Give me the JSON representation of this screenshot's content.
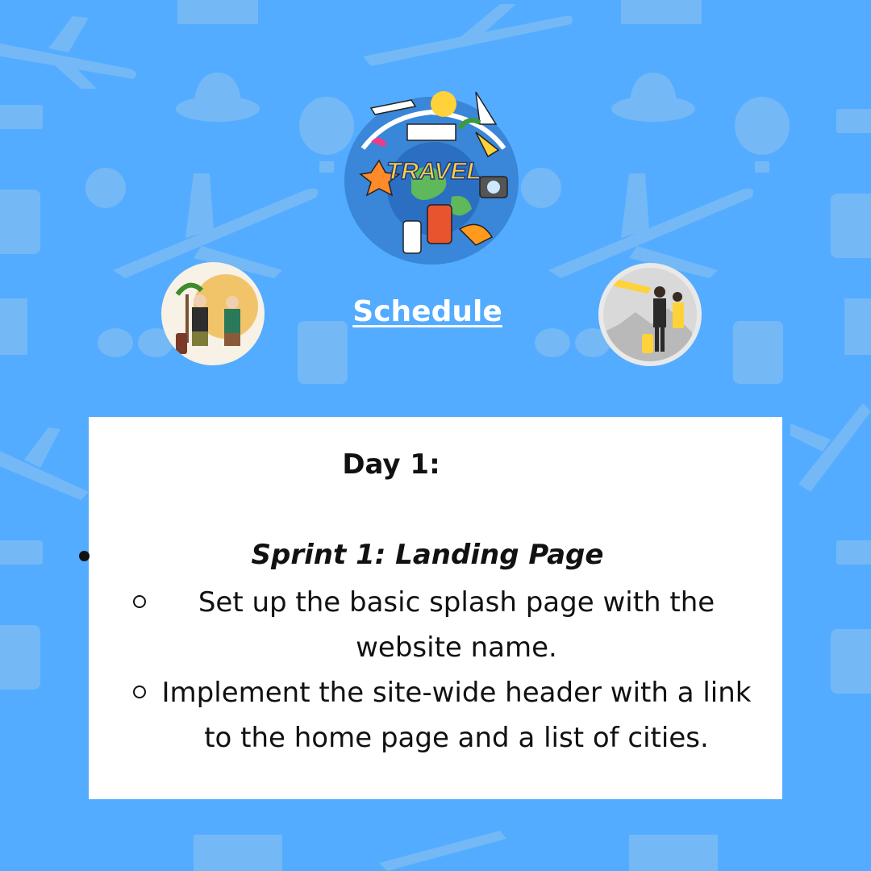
{
  "heading": "Schedule",
  "day": {
    "title": "Day 1:",
    "sprint": "Sprint 1: Landing Page",
    "tasks": [
      "Set up the basic splash page with the website name.",
      "Implement the site-wide header with a link to the home page and a list of cities."
    ]
  },
  "logo": {
    "text": "TRAVEL"
  },
  "icons": [
    "airplane-icon",
    "hat-icon",
    "hot-air-balloon-icon",
    "suitcase-icon",
    "compass-icon",
    "sunglasses-icon",
    "wallet-icon",
    "ticket-icon",
    "map-icon"
  ],
  "colors": {
    "background": "#53acff",
    "card": "#ffffff",
    "text": "#111111",
    "heading": "#ffffff"
  }
}
